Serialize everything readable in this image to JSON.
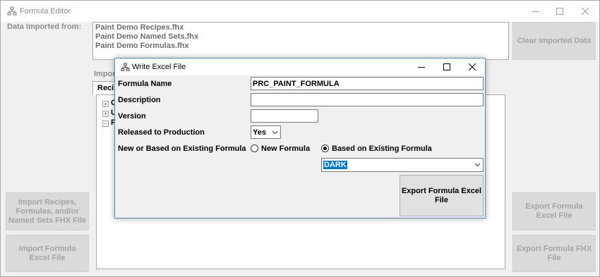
{
  "main_window": {
    "title": "Formula Editor",
    "data_imported_label": "Data Imported from:",
    "imported_files": [
      "Paint Demo Recipes.fhx",
      "Paint Demo Named Sets.fhx",
      "Paint Demo Formulas.fhx"
    ],
    "clear_button": "Clear Imported Data",
    "import_section_label": "Impor",
    "tab_label": "Recip",
    "tree_items": [
      "C",
      "U",
      "P"
    ],
    "import_fhx_button": "Import Recipes, Formulas, and/or Named Sets FHX File",
    "import_excel_button": "Import Formula Excel File",
    "export_excel_button": "Export Formula Excel File",
    "export_fhx_button": "Export Formula FHX File"
  },
  "dialog": {
    "title": "Write Excel File",
    "formula_name_label": "Formula Name",
    "formula_name_value": "PRC_PAINT_FORMULA",
    "description_label": "Description",
    "description_value": "",
    "version_label": "Version",
    "version_value": "",
    "released_label": "Released to Production",
    "released_value": "Yes",
    "new_or_based_label": "New or Based on Existing Formula",
    "radio_new_label": "New Formula",
    "radio_based_label": "Based on Existing Formula",
    "selected_radio": "based",
    "existing_formula_value": "DARK",
    "export_button": "Export Formula Excel File"
  },
  "icons": {
    "app": "app-tree-icon",
    "minimize": "minimize-icon",
    "maximize": "maximize-icon",
    "close": "close-icon"
  }
}
